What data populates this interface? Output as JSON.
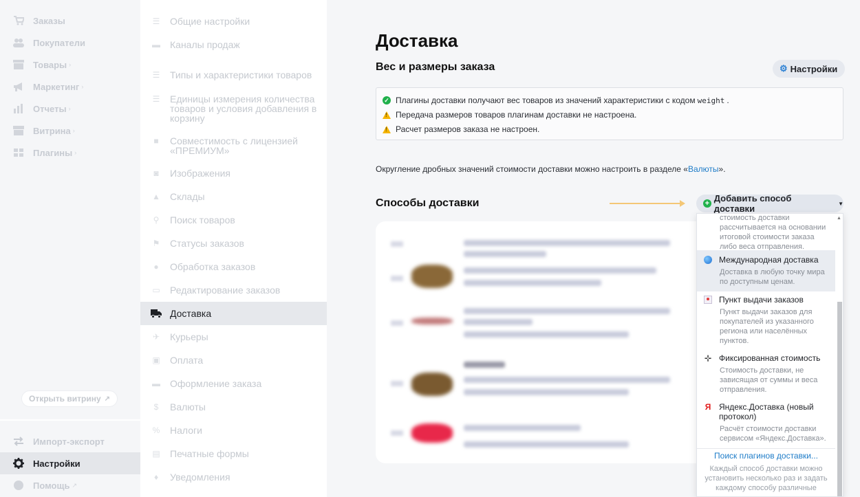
{
  "main_nav": {
    "items": [
      {
        "label": "Заказы",
        "icon": "cart-icon"
      },
      {
        "label": "Покупатели",
        "icon": "users-icon"
      },
      {
        "label": "Товары",
        "icon": "box-icon",
        "chevron": "›"
      },
      {
        "label": "Маркетинг",
        "icon": "megaphone-icon",
        "chevron": "›"
      },
      {
        "label": "Отчеты",
        "icon": "chart-icon",
        "chevron": "›"
      },
      {
        "label": "Витрина",
        "icon": "storefront-icon",
        "chevron": "›"
      },
      {
        "label": "Плагины",
        "icon": "puzzle-icon",
        "chevron": "›"
      }
    ],
    "open_storefront": "Открыть витрину",
    "bottom": [
      {
        "label": "Импорт-экспорт",
        "icon": "import-export-icon"
      },
      {
        "label": "Настройки",
        "icon": "gear-icon"
      },
      {
        "label": "Помощь",
        "icon": "help-icon"
      }
    ]
  },
  "settings_nav": {
    "items": [
      {
        "label": "Общие настройки",
        "icon": "list-icon"
      },
      {
        "label": "Каналы продаж",
        "icon": "cart-icon"
      },
      {
        "label": "Типы и характеристики товаров",
        "icon": "list-icon"
      },
      {
        "label": "Единицы измерения количества товаров и условия добавления в корзину",
        "icon": "list-icon"
      },
      {
        "label": "Совместимость с лицензией «ПРЕМИУМ»",
        "icon": "puzzle-icon"
      },
      {
        "label": "Изображения",
        "icon": "camera-icon"
      },
      {
        "label": "Склады",
        "icon": "warehouse-icon"
      },
      {
        "label": "Поиск товаров",
        "icon": "search-icon"
      },
      {
        "label": "Статусы заказов",
        "icon": "flag-icon"
      },
      {
        "label": "Обработка заказов",
        "icon": "clock-icon"
      },
      {
        "label": "Редактирование заказов",
        "icon": "card-icon"
      },
      {
        "label": "Доставка",
        "icon": "truck-icon"
      },
      {
        "label": "Курьеры",
        "icon": "walker-icon"
      },
      {
        "label": "Оплата",
        "icon": "wallet-icon"
      },
      {
        "label": "Оформление заказа",
        "icon": "cart-icon"
      },
      {
        "label": "Валюты",
        "icon": "dollar-icon"
      },
      {
        "label": "Налоги",
        "icon": "percent-icon"
      },
      {
        "label": "Печатные формы",
        "icon": "printer-icon"
      },
      {
        "label": "Уведомления",
        "icon": "bell-icon"
      }
    ]
  },
  "content": {
    "page_title": "Доставка",
    "weight_section_title": "Вес и размеры заказа",
    "settings_button": "Настройки",
    "notices": {
      "n1_before": "Плагины доставки получают вес товаров из значений характеристики с кодом",
      "n1_code": "weight",
      "n1_after": ".",
      "n2": "Передача размеров товаров плагинам доставки не настроена.",
      "n3": "Расчет размеров заказа не настроен."
    },
    "rounding_before": "Округление дробных значений стоимости доставки можно настроить в разделе «",
    "rounding_link": "Валюты",
    "rounding_after": "».",
    "methods_title": "Способы доставки",
    "add_method_button": "Добавить способ доставки"
  },
  "dropdown": {
    "top_partial_desc": "стоимость доставки рассчитывается на основании итоговой стоимости заказа либо веса отправления.",
    "items": [
      {
        "name": "Международная доставка",
        "desc": "Доставка в любую точку мира по доступным ценам.",
        "icon": "globe-icon"
      },
      {
        "name": "Пункт выдачи заказов",
        "desc": "Пункт выдачи заказов для покупателей из указанного региона или населённых пунктов.",
        "icon": "pickup-point-icon"
      },
      {
        "name": "Фиксированная стоимость",
        "desc": "Стоимость доставки, не зависящая от суммы и веса отправления.",
        "icon": "fixed-price-icon"
      },
      {
        "name": "Яндекс.Доставка (новый протокол)",
        "desc": "Расчёт стоимости доставки сервисом «Яндекс.Доставка».",
        "icon": "yandex-icon"
      }
    ],
    "search_link": "Поиск плагинов доставки...",
    "footer": "Каждый способ доставки можно установить несколько раз и задать каждому способу различные"
  },
  "colors": {
    "accent": "#1e7cc8",
    "success": "#20b04b",
    "warning": "#f5b400",
    "sidebar_bg": "#f5f6f8"
  }
}
